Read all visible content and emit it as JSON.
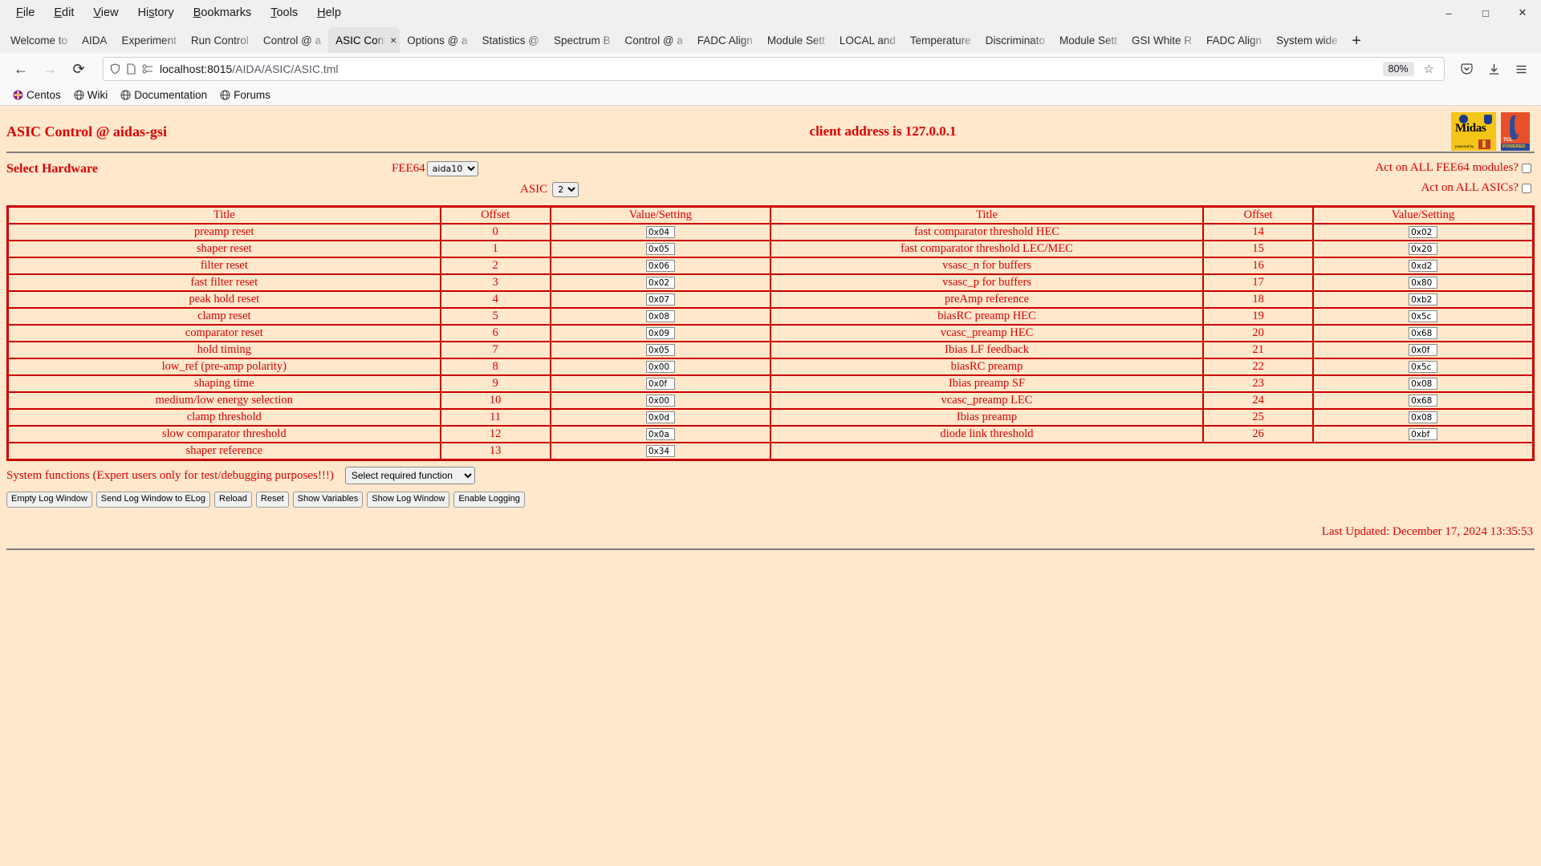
{
  "browser": {
    "menus": [
      "File",
      "Edit",
      "View",
      "History",
      "Bookmarks",
      "Tools",
      "Help"
    ],
    "window_controls": {
      "minimize": "–",
      "maximize": "□",
      "close": "✕"
    },
    "tabs": [
      {
        "label": "Welcome to",
        "active": false
      },
      {
        "label": "AIDA",
        "active": false,
        "narrow": true
      },
      {
        "label": "Experiment",
        "active": false
      },
      {
        "label": "Run Control",
        "active": false
      },
      {
        "label": "Control @ a",
        "active": false
      },
      {
        "label": "ASIC Cont",
        "active": true
      },
      {
        "label": "Options @ a",
        "active": false
      },
      {
        "label": "Statistics @",
        "active": false
      },
      {
        "label": "Spectrum B",
        "active": false
      },
      {
        "label": "Control @ a",
        "active": false
      },
      {
        "label": "FADC Align",
        "active": false
      },
      {
        "label": "Module Sett",
        "active": false
      },
      {
        "label": "LOCAL and",
        "active": false
      },
      {
        "label": "Temperature",
        "active": false
      },
      {
        "label": "Discriminato",
        "active": false
      },
      {
        "label": "Module Sett",
        "active": false
      },
      {
        "label": "GSI White R",
        "active": false
      },
      {
        "label": "FADC Align",
        "active": false
      },
      {
        "label": "System wide",
        "active": false
      }
    ],
    "new_tab_label": "+",
    "nav": {
      "back": "←",
      "forward": "→",
      "reload": "⟳"
    },
    "url": {
      "host": "localhost:8015",
      "path": "/AIDA/ASIC/ASIC.tml"
    },
    "zoom_level": "80%",
    "bookmarks": [
      "Centos",
      "Wiki",
      "Documentation",
      "Forums"
    ]
  },
  "page": {
    "title": "ASIC Control @ aidas-gsi",
    "client_address": "client address is 127.0.0.1",
    "select_hardware_label": "Select Hardware",
    "fee64_label": "FEE64",
    "fee64_value": "aida10",
    "asic_label": "ASIC",
    "asic_value": "2",
    "act_all_fee64_label": "Act on ALL FEE64 modules?",
    "act_all_asics_label": "Act on ALL ASICs?",
    "columns": {
      "title": "Title",
      "offset": "Offset",
      "value": "Value/Setting"
    },
    "rows_left": [
      {
        "title": "preamp reset",
        "offset": "0",
        "value": "0x04"
      },
      {
        "title": "shaper reset",
        "offset": "1",
        "value": "0x05"
      },
      {
        "title": "filter reset",
        "offset": "2",
        "value": "0x06"
      },
      {
        "title": "fast filter reset",
        "offset": "3",
        "value": "0x02"
      },
      {
        "title": "peak hold reset",
        "offset": "4",
        "value": "0x07"
      },
      {
        "title": "clamp reset",
        "offset": "5",
        "value": "0x08"
      },
      {
        "title": "comparator reset",
        "offset": "6",
        "value": "0x09"
      },
      {
        "title": "hold timing",
        "offset": "7",
        "value": "0x05"
      },
      {
        "title": "low_ref (pre-amp polarity)",
        "offset": "8",
        "value": "0x00"
      },
      {
        "title": "shaping time",
        "offset": "9",
        "value": "0x0f"
      },
      {
        "title": "medium/low energy selection",
        "offset": "10",
        "value": "0x00"
      },
      {
        "title": "clamp threshold",
        "offset": "11",
        "value": "0x0d"
      },
      {
        "title": "slow comparator threshold",
        "offset": "12",
        "value": "0x0a"
      },
      {
        "title": "shaper reference",
        "offset": "13",
        "value": "0x34"
      }
    ],
    "rows_right": [
      {
        "title": "fast comparator threshold HEC",
        "offset": "14",
        "value": "0x02"
      },
      {
        "title": "fast comparator threshold LEC/MEC",
        "offset": "15",
        "value": "0x20"
      },
      {
        "title": "vsasc_n for buffers",
        "offset": "16",
        "value": "0xd2"
      },
      {
        "title": "vsasc_p for buffers",
        "offset": "17",
        "value": "0x80"
      },
      {
        "title": "preAmp reference",
        "offset": "18",
        "value": "0xb2"
      },
      {
        "title": "biasRC preamp HEC",
        "offset": "19",
        "value": "0x5c"
      },
      {
        "title": "vcasc_preamp HEC",
        "offset": "20",
        "value": "0x68"
      },
      {
        "title": "Ibias LF feedback",
        "offset": "21",
        "value": "0x0f"
      },
      {
        "title": "biasRC preamp",
        "offset": "22",
        "value": "0x5c"
      },
      {
        "title": "Ibias preamp SF",
        "offset": "23",
        "value": "0x08"
      },
      {
        "title": "vcasc_preamp LEC",
        "offset": "24",
        "value": "0x68"
      },
      {
        "title": "Ibias preamp",
        "offset": "25",
        "value": "0x08"
      },
      {
        "title": "diode link threshold",
        "offset": "26",
        "value": "0xbf"
      },
      {
        "title": "",
        "offset": "",
        "value": ""
      }
    ],
    "system_functions_label": "System functions (Expert users only for test/debugging purposes!!!)",
    "system_function_select": "Select required function",
    "buttons": [
      "Empty Log Window",
      "Send Log Window to ELog",
      "Reload",
      "Reset",
      "Show Variables",
      "Show Log Window",
      "Enable Logging"
    ],
    "last_updated": "Last Updated: December 17, 2024 13:35:53"
  },
  "colors": {
    "page_bg": "#ffe8cc",
    "accent_red": "#dd0000",
    "table_border": "#cc0000"
  }
}
